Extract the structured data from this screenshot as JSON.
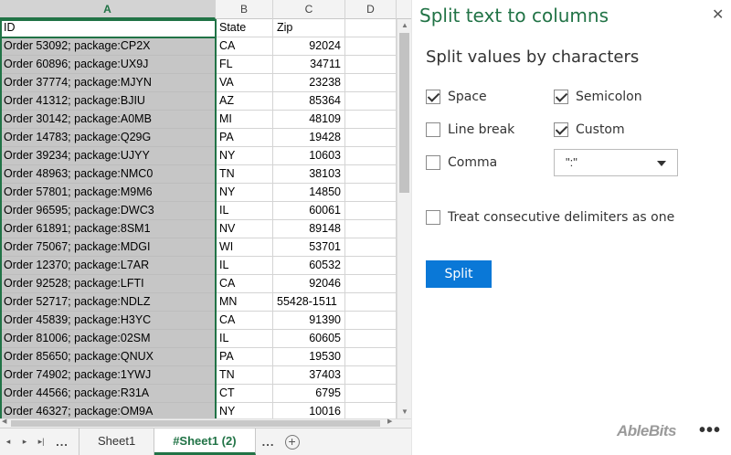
{
  "sheet": {
    "columns": [
      "A",
      "B",
      "C",
      "D"
    ],
    "rows": [
      [
        "ID",
        "State",
        "Zip",
        ""
      ],
      [
        "Order 53092; package:CP2X",
        "CA",
        "92024",
        ""
      ],
      [
        "Order 60896; package:UX9J",
        "FL",
        "34711",
        ""
      ],
      [
        "Order 37774; package:MJYN",
        "VA",
        "23238",
        ""
      ],
      [
        "Order 41312; package:BJIU",
        "AZ",
        "85364",
        ""
      ],
      [
        "Order 30142; package:A0MB",
        "MI",
        "48109",
        ""
      ],
      [
        "Order 14783; package:Q29G",
        "PA",
        "19428",
        ""
      ],
      [
        "Order 39234; package:UJYY",
        "NY",
        "10603",
        ""
      ],
      [
        "Order 48963; package:NMC0",
        "TN",
        "38103",
        ""
      ],
      [
        "Order 57801; package:M9M6",
        "NY",
        "14850",
        ""
      ],
      [
        "Order 96595; package:DWC3",
        "IL",
        "60061",
        ""
      ],
      [
        "Order 61891; package:8SM1",
        "NV",
        "89148",
        ""
      ],
      [
        "Order 75067; package:MDGI",
        "WI",
        "53701",
        ""
      ],
      [
        "Order 12370; package:L7AR",
        "IL",
        "60532",
        ""
      ],
      [
        "Order 92528; package:LFTI",
        "CA",
        "92046",
        ""
      ],
      [
        "Order 52717; package:NDLZ",
        "MN",
        "55428-1511",
        ""
      ],
      [
        "Order 45839; package:H3YC",
        "CA",
        "91390",
        ""
      ],
      [
        "Order 81006; package:02SM",
        "IL",
        "60605",
        ""
      ],
      [
        "Order 85650; package:QNUX",
        "PA",
        "19530",
        ""
      ],
      [
        "Order 74902; package:1YWJ",
        "TN",
        "37403",
        ""
      ],
      [
        "Order 44566; package:R31A",
        "CT",
        "6795",
        ""
      ],
      [
        "Order 46327; package:OM9A",
        "NY",
        "10016",
        ""
      ]
    ]
  },
  "tabs": {
    "nav_prev": "◂",
    "nav_next": "▸",
    "nav_last": "▸|",
    "dots": "...",
    "items": [
      "Sheet1",
      "#Sheet1 (2)"
    ],
    "active": "#Sheet1 (2)",
    "add": "+"
  },
  "panel": {
    "title": "Split text to columns",
    "close": "✕",
    "section_title": "Split values by characters",
    "options": {
      "space": {
        "label": "Space",
        "checked": true
      },
      "semicolon": {
        "label": "Semicolon",
        "checked": true
      },
      "line_break": {
        "label": "Line break",
        "checked": false
      },
      "custom": {
        "label": "Custom",
        "checked": true
      },
      "comma": {
        "label": "Comma",
        "checked": false
      },
      "consecutive": {
        "label": "Treat consecutive delimiters as one",
        "checked": false
      }
    },
    "custom_value": "\":\"",
    "split_button": "Split",
    "brand": "AbleBits",
    "more": "•••"
  },
  "colors": {
    "excel_green": "#217346",
    "button_blue": "#0a78d7",
    "selection_gray": "#c6c6c6"
  }
}
